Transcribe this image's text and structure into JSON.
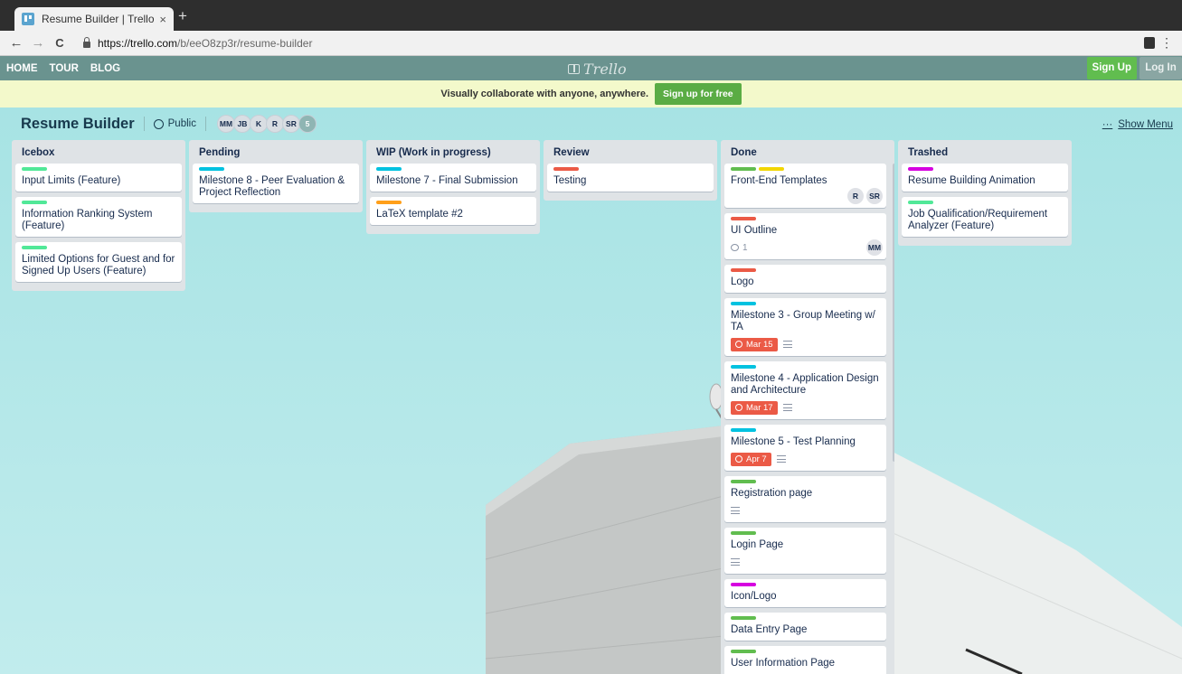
{
  "browser": {
    "tab_title": "Resume Builder | Trello",
    "tab_close": "×",
    "new_tab": "+",
    "back": "←",
    "forward": "→",
    "reload": "C",
    "url_host": "https://trello.com",
    "url_path": "/b/eeO8zp3r/resume-builder",
    "menu": "⋮"
  },
  "header": {
    "nav": [
      "HOME",
      "TOUR",
      "BLOG"
    ],
    "logo": "Trello",
    "signup": "Sign Up",
    "login": "Log In"
  },
  "promo": {
    "text": "Visually collaborate with anyone, anywhere.",
    "button": "Sign up for free"
  },
  "board": {
    "title": "Resume Builder",
    "visibility": "Public",
    "members": [
      "MM",
      "JB",
      "K",
      "R",
      "SR",
      "5"
    ],
    "show_menu_dots": "···",
    "show_menu": "Show Menu"
  },
  "colors": {
    "green": "#61bd4f",
    "mint": "#51e898",
    "blue": "#00c2e0",
    "orange": "#ff9f1a",
    "red": "#eb5a46",
    "yellow": "#f2d600",
    "purple": "#c377e0",
    "magenta": "#d600e0",
    "header": "#6a938f",
    "board_bg": "#abe5e6"
  },
  "lists": [
    {
      "title": "Icebox",
      "cards": [
        {
          "labels": [
            "mint"
          ],
          "title": "Input Limits (Feature)"
        },
        {
          "labels": [
            "mint"
          ],
          "title": "Information Ranking System (Feature)"
        },
        {
          "labels": [
            "mint"
          ],
          "title": "Limited Options for Guest and for Signed Up Users (Feature)"
        }
      ]
    },
    {
      "title": "Pending",
      "cards": [
        {
          "labels": [
            "blue"
          ],
          "title": "Milestone 8 - Peer Evaluation & Project Reflection"
        }
      ]
    },
    {
      "title": "WIP (Work in progress)",
      "cards": [
        {
          "labels": [
            "blue"
          ],
          "title": "Milestone 7 - Final Submission"
        },
        {
          "labels": [
            "orange"
          ],
          "title": "LaTeX template #2"
        }
      ]
    },
    {
      "title": "Review",
      "cards": [
        {
          "labels": [
            "red"
          ],
          "title": "Testing"
        }
      ]
    },
    {
      "title": "Done",
      "cards": [
        {
          "labels": [
            "green",
            "yellow"
          ],
          "title": "Front-End Templates",
          "members": [
            "R",
            "SR"
          ]
        },
        {
          "labels": [
            "red"
          ],
          "title": "UI Outline",
          "comments": "1",
          "members": [
            "MM"
          ]
        },
        {
          "labels": [
            "red"
          ],
          "title": "Logo"
        },
        {
          "labels": [
            "blue"
          ],
          "title": "Milestone 3 - Group Meeting w/ TA",
          "due": "Mar 15",
          "desc": true
        },
        {
          "labels": [
            "blue"
          ],
          "title": "Milestone 4 - Application Design and Architecture",
          "due": "Mar 17",
          "desc": true
        },
        {
          "labels": [
            "blue"
          ],
          "title": "Milestone 5 - Test Planning",
          "due": "Apr 7",
          "desc": true
        },
        {
          "labels": [
            "green"
          ],
          "title": "Registration page",
          "desc": true
        },
        {
          "labels": [
            "green"
          ],
          "title": "Login Page",
          "desc": true
        },
        {
          "labels": [
            "magenta"
          ],
          "title": "Icon/Logo"
        },
        {
          "labels": [
            "green"
          ],
          "title": "Data Entry Page"
        },
        {
          "labels": [
            "green"
          ],
          "title": "User Information Page",
          "desc": true
        }
      ]
    },
    {
      "title": "Trashed",
      "cards": [
        {
          "labels": [
            "magenta"
          ],
          "title": "Resume Building Animation"
        },
        {
          "labels": [
            "mint"
          ],
          "title": "Job Qualification/Requirement Analyzer (Feature)"
        }
      ]
    }
  ]
}
